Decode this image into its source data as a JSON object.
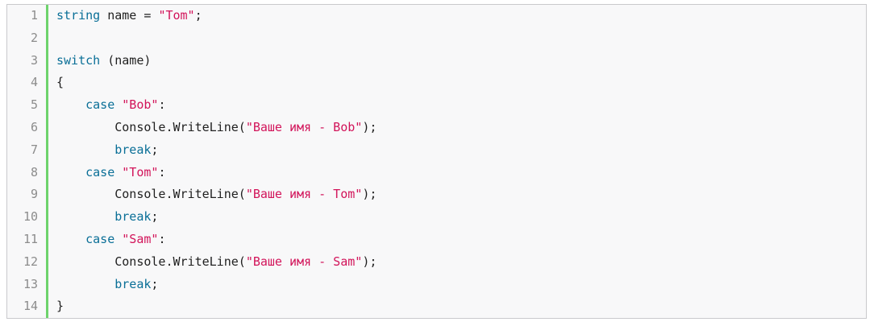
{
  "colors": {
    "keyword": "#0a6f97",
    "string": "#d2145a",
    "text": "#1f1f1f",
    "line_number": "#8c8c8c",
    "gutter_bar": "#6ed36c",
    "background": "#f8f8f9"
  },
  "code": {
    "lines": [
      {
        "n": "1",
        "tokens": [
          {
            "t": "string",
            "k": "kw"
          },
          {
            "t": " name = ",
            "k": "plain"
          },
          {
            "t": "\"Tom\"",
            "k": "str"
          },
          {
            "t": ";",
            "k": "plain"
          }
        ]
      },
      {
        "n": "2",
        "tokens": []
      },
      {
        "n": "3",
        "tokens": [
          {
            "t": "switch",
            "k": "kw"
          },
          {
            "t": " (name)",
            "k": "plain"
          }
        ]
      },
      {
        "n": "4",
        "tokens": [
          {
            "t": "{",
            "k": "plain"
          }
        ]
      },
      {
        "n": "5",
        "tokens": [
          {
            "t": "    ",
            "k": "plain"
          },
          {
            "t": "case",
            "k": "kw"
          },
          {
            "t": " ",
            "k": "plain"
          },
          {
            "t": "\"Bob\"",
            "k": "str"
          },
          {
            "t": ":",
            "k": "plain"
          }
        ]
      },
      {
        "n": "6",
        "tokens": [
          {
            "t": "        Console.WriteLine(",
            "k": "plain"
          },
          {
            "t": "\"Ваше имя - Bob\"",
            "k": "str"
          },
          {
            "t": ");",
            "k": "plain"
          }
        ]
      },
      {
        "n": "7",
        "tokens": [
          {
            "t": "        ",
            "k": "plain"
          },
          {
            "t": "break",
            "k": "kw"
          },
          {
            "t": ";",
            "k": "plain"
          }
        ]
      },
      {
        "n": "8",
        "tokens": [
          {
            "t": "    ",
            "k": "plain"
          },
          {
            "t": "case",
            "k": "kw"
          },
          {
            "t": " ",
            "k": "plain"
          },
          {
            "t": "\"Tom\"",
            "k": "str"
          },
          {
            "t": ":",
            "k": "plain"
          }
        ]
      },
      {
        "n": "9",
        "tokens": [
          {
            "t": "        Console.WriteLine(",
            "k": "plain"
          },
          {
            "t": "\"Ваше имя - Tom\"",
            "k": "str"
          },
          {
            "t": ");",
            "k": "plain"
          }
        ]
      },
      {
        "n": "10",
        "tokens": [
          {
            "t": "        ",
            "k": "plain"
          },
          {
            "t": "break",
            "k": "kw"
          },
          {
            "t": ";",
            "k": "plain"
          }
        ]
      },
      {
        "n": "11",
        "tokens": [
          {
            "t": "    ",
            "k": "plain"
          },
          {
            "t": "case",
            "k": "kw"
          },
          {
            "t": " ",
            "k": "plain"
          },
          {
            "t": "\"Sam\"",
            "k": "str"
          },
          {
            "t": ":",
            "k": "plain"
          }
        ]
      },
      {
        "n": "12",
        "tokens": [
          {
            "t": "        Console.WriteLine(",
            "k": "plain"
          },
          {
            "t": "\"Ваше имя - Sam\"",
            "k": "str"
          },
          {
            "t": ");",
            "k": "plain"
          }
        ]
      },
      {
        "n": "13",
        "tokens": [
          {
            "t": "        ",
            "k": "plain"
          },
          {
            "t": "break",
            "k": "kw"
          },
          {
            "t": ";",
            "k": "plain"
          }
        ]
      },
      {
        "n": "14",
        "tokens": [
          {
            "t": "}",
            "k": "plain"
          }
        ]
      }
    ]
  }
}
